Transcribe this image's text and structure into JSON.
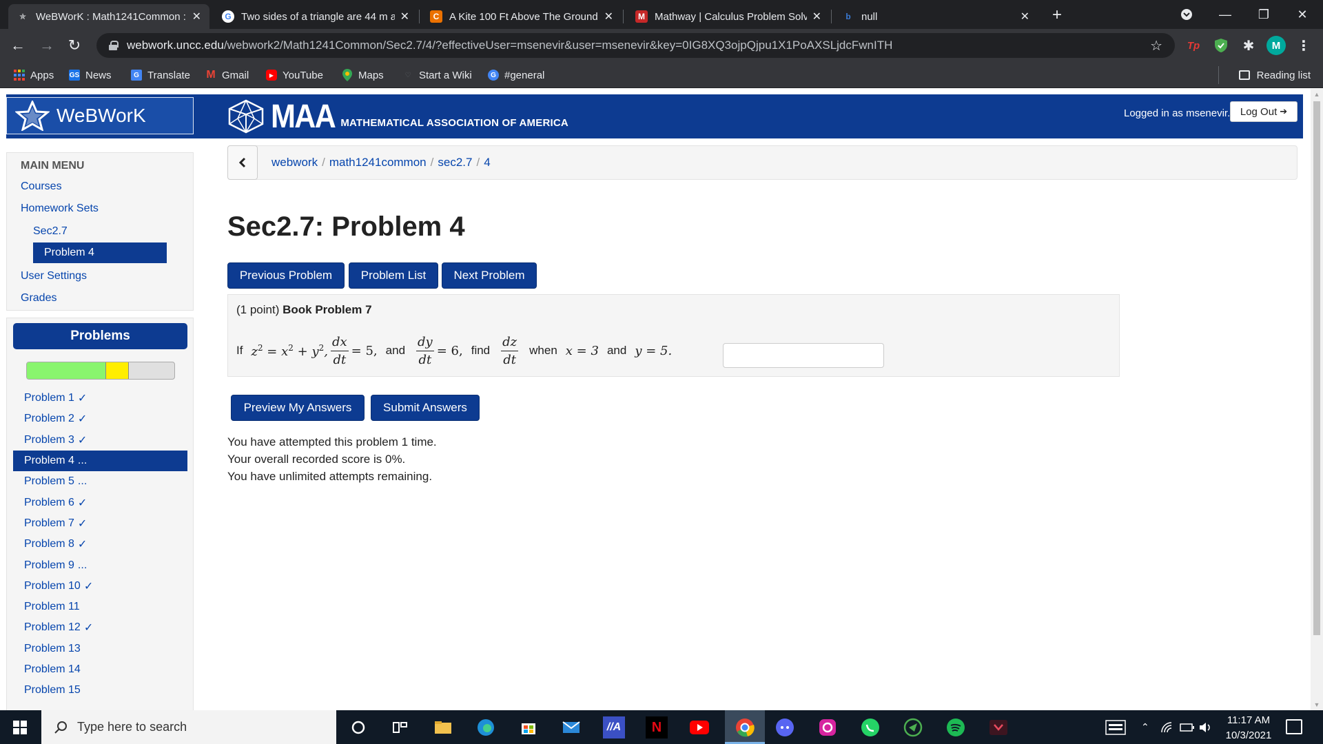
{
  "browser": {
    "tabs": [
      {
        "title": "WeBWorK : Math1241Common :",
        "active": true
      },
      {
        "title": "Two sides of a triangle are 44 m a",
        "active": false
      },
      {
        "title": "A Kite 100 Ft Above The Ground",
        "active": false
      },
      {
        "title": "Mathway | Calculus Problem Solv",
        "active": false
      },
      {
        "title": "null",
        "active": false
      }
    ],
    "url_host": "webwork.uncc.edu",
    "url_path": "/webwork2/Math1241Common/Sec2.7/4/?effectiveUser=msenevir&user=msenevir&key=0IG8XQ3ojpQjpu1X1PoAXSLjdcFwnITH",
    "profile_initial": "M",
    "bookmarks": [
      "Apps",
      "News",
      "Translate",
      "Gmail",
      "YouTube",
      "Maps",
      "Start a Wiki",
      "#general"
    ],
    "reading_list": "Reading list"
  },
  "header": {
    "app_name": "WeBWorK",
    "maa_abbr": "MAA",
    "maa_name": "MATHEMATICAL ASSOCIATION OF AMERICA",
    "logged_in": "Logged in as msenevir.",
    "logout_label": "Log Out"
  },
  "sidebar": {
    "menu_title": "MAIN MENU",
    "links": [
      "Courses",
      "Homework Sets",
      "Sec2.7",
      "Problem 4",
      "User Settings",
      "Grades"
    ],
    "problems_title": "Problems",
    "progress": {
      "correct_fraction": 0.538,
      "partial_fraction": 0.154,
      "green": "#89f56e",
      "yellow": "#ffee00"
    },
    "problems": [
      {
        "label": "Problem 1",
        "mark": "✓"
      },
      {
        "label": "Problem 2",
        "mark": "✓"
      },
      {
        "label": "Problem 3",
        "mark": "✓"
      },
      {
        "label": "Problem 4",
        "mark": "...",
        "active": true
      },
      {
        "label": "Problem 5",
        "mark": "..."
      },
      {
        "label": "Problem 6",
        "mark": "✓"
      },
      {
        "label": "Problem 7",
        "mark": "✓"
      },
      {
        "label": "Problem 8",
        "mark": "✓"
      },
      {
        "label": "Problem 9",
        "mark": "..."
      },
      {
        "label": "Problem 10",
        "mark": "✓"
      },
      {
        "label": "Problem 11",
        "mark": ""
      },
      {
        "label": "Problem 12",
        "mark": "✓"
      },
      {
        "label": "Problem 13",
        "mark": ""
      },
      {
        "label": "Problem 14",
        "mark": ""
      },
      {
        "label": "Problem 15",
        "mark": ""
      }
    ]
  },
  "main": {
    "breadcrumb": [
      "webwork",
      "math1241common",
      "sec2.7",
      "4"
    ],
    "title": "Sec2.7: Problem 4",
    "nav_buttons": {
      "previous": "Previous Problem",
      "list": "Problem List",
      "next": "Next Problem"
    },
    "problem": {
      "points": "(1 point)",
      "book_label": "Book Problem 7",
      "text": {
        "if": "If",
        "and1": "and",
        "find": "find",
        "when": "when",
        "and2": "and"
      },
      "answer_value": ""
    },
    "action_buttons": {
      "preview": "Preview My Answers",
      "submit": "Submit Answers"
    },
    "status_lines": [
      "You have attempted this problem 1 time.",
      "Your overall recorded score is 0%.",
      "You have unlimited attempts remaining."
    ]
  },
  "taskbar": {
    "search_placeholder": "Type here to search",
    "time": "11:17 AM",
    "date": "10/3/2021"
  },
  "colors": {
    "webwork_blue": "#0d3b91",
    "chrome_dark": "#202124",
    "link": "#0645ad"
  }
}
